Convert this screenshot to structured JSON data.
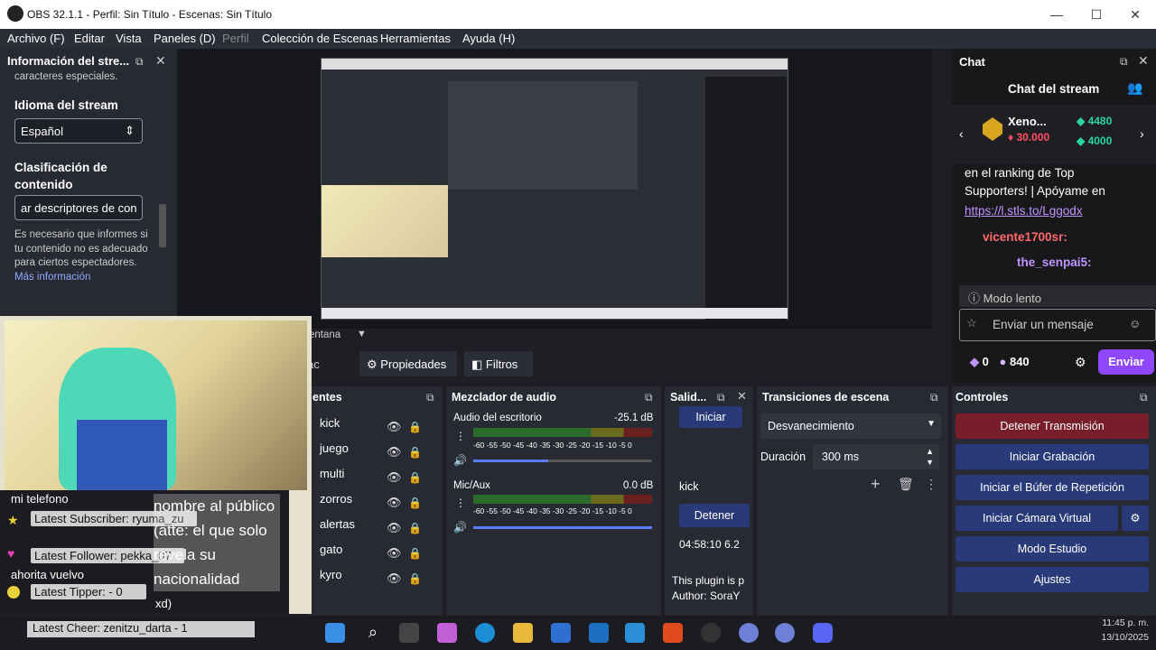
{
  "window": {
    "title": "OBS 32.1.1 - Perfil: Sin Título - Escenas: Sin Título",
    "minimize": "—",
    "maximize": "☐",
    "close": "✕"
  },
  "menu": [
    "Archivo (F)",
    "Editar",
    "Vista",
    "Paneles (D)",
    "Perfil",
    "Colección de Escenas",
    "Herramientas",
    "Ayuda (H)"
  ],
  "stream_info": {
    "title": "Información del stre...",
    "special_chars": "caracteres especiales.",
    "language_label": "Idioma del stream",
    "language_value": "Español",
    "classification_label": "Clasificación de contenido",
    "classification_value": "ar descriptores de con",
    "help_text": "Es necesario que informes si tu contenido no es adecuado para ciertos espectadores.",
    "more_info": "Más información"
  },
  "preview_label": "entana",
  "chat": {
    "header": "Chat",
    "title": "Chat del stream",
    "top_user": "Xeno...",
    "top_bits": "30.000",
    "top_a": "4480",
    "top_b": "4000",
    "message": "en el ranking de Top Supporters! | Apóyame en",
    "link": "https://l.stls.to/Lggodx",
    "user1": "vicente1700sr:",
    "user2": "the_senpai5:",
    "slow_mode": "Modo lento",
    "placeholder": "Enviar un mensaje",
    "points": "0",
    "channel_points": "840",
    "send": "Enviar"
  },
  "toolbar": {
    "properties": "Propiedades",
    "filters": "Filtros"
  },
  "sources": {
    "header": "entes",
    "items": [
      "kick",
      "juego",
      "multi",
      "zorros",
      "alertas",
      "gato",
      "kyro"
    ]
  },
  "mixer": {
    "header": "Mezclador de audio",
    "ch1_name": "Audio del escritorio",
    "ch1_db": "-25.1 dB",
    "ch2_name": "Mic/Aux",
    "ch2_db": "0.0 dB",
    "ticks": "-60 -55 -50 -45 -40 -35 -30 -25 -20 -15 -10 -5 0"
  },
  "output": {
    "header": "Salid...",
    "start": "Iniciar",
    "kick": "kick",
    "stop": "Detener",
    "time": "04:58:10",
    "partial": "6.2",
    "plugin": "This plugin is p",
    "author": "Author: SoraY"
  },
  "transitions": {
    "header": "Transiciones de escena",
    "type": "Desvanecimiento",
    "duration_label": "Duración",
    "duration_value": "300 ms"
  },
  "controls": {
    "header": "Controles",
    "stop_stream": "Detener Transmisión",
    "start_rec": "Iniciar Grabación",
    "replay": "Iniciar el Búfer de Repetición",
    "virtual_cam": "Iniciar Cámara Virtual",
    "studio": "Modo Estudio",
    "settings": "Ajustes"
  },
  "overlay": {
    "phone": "mi telefono",
    "subscriber": "Latest Subscriber: ryuma_zu",
    "follower": "Latest Follower: pekka_07",
    "tipper": "Latest Tipper:  -  0",
    "cheer": "Latest Cheer: zenitzu_darta - 1",
    "back": "ahorita vuelvo",
    "note": "nombre al público (atte: el que solo revela su nacionalidad",
    "xd": "xd)"
  },
  "taskbar": {
    "time": "11:45 p. m.",
    "date": "13/10/2025"
  },
  "colors": {
    "accent": "#9146ff",
    "blue_button": "#283a7a",
    "red_button": "#7a1d2a"
  }
}
